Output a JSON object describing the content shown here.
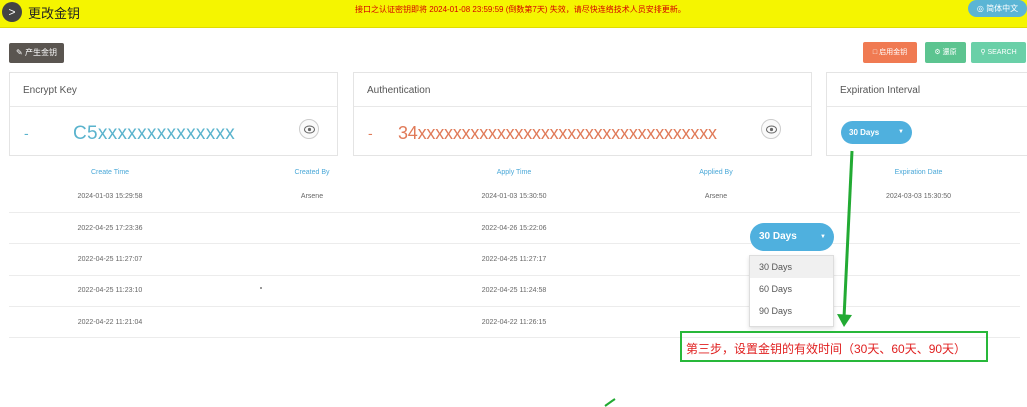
{
  "header": {
    "back_icon": "chevron-right-icon",
    "title": "更改金钥",
    "notice": "接口之认证密钥即将 2024-01-08 23:59:59 (倒数第7天) 失效，请尽快连络技术人员安排更新。",
    "language_icon": "globe-icon",
    "language_label": "简体中文"
  },
  "toolbar": {
    "generate_label": "产生金钥",
    "generate_icon": "edit-icon",
    "apply_label": "启用金钥",
    "apply_icon": "document-icon",
    "refresh_label": "還原",
    "refresh_icon": "gear-icon",
    "search_label": "SEARCH",
    "search_icon": "search-icon",
    "colors": {
      "apply": "#f07a52",
      "refresh": "#5cc490",
      "search": "#6ad0a8"
    }
  },
  "cards": {
    "encrypt": {
      "title": "Encrypt Key",
      "dash": "-",
      "value": "C5xxxxxxxxxxxxxx",
      "color": "#5ab3cd",
      "icon": "eye-icon"
    },
    "auth": {
      "title": "Authentication",
      "dash": "-",
      "value": "34xxxxxxxxxxxxxxxxxxxxxxxxxxxxxxxxxx",
      "color": "#e07a58",
      "icon": "eye-icon"
    },
    "expiration": {
      "title": "Expiration Interval",
      "selected": "30 Days",
      "caret": "▼"
    }
  },
  "table": {
    "headers": [
      "Create Time",
      "Created By",
      "Apply Time",
      "Applied By",
      "Expiration Date"
    ],
    "rows": [
      [
        "2024-01-03 15:29:58",
        "Arsene",
        "2024-01-03 15:30:50",
        "Arsene",
        "2024-03-03 15:30:50"
      ],
      [
        "2022-04-25 17:23:36",
        "",
        "2022-04-26 15:22:06",
        "",
        ""
      ],
      [
        "2022-04-25 11:27:07",
        "",
        "2022-04-25 11:27:17",
        "",
        ""
      ],
      [
        "2022-04-25 11:23:10",
        "",
        "2022-04-25 11:24:58",
        "",
        ""
      ],
      [
        "2022-04-22 11:21:04",
        "",
        "2022-04-22 11:26:15",
        "",
        ""
      ]
    ]
  },
  "dropdown": {
    "selected": "30 Days",
    "caret": "▼",
    "options": [
      "30 Days",
      "60 Days",
      "90 Days"
    ],
    "highlighted_index": 0
  },
  "annotation": {
    "text": "第三步，设置金钥的有效时间（30天、60天、90天）",
    "border_color": "#28b83a",
    "text_color": "#e02020",
    "arrow_color": "#22aa33"
  }
}
